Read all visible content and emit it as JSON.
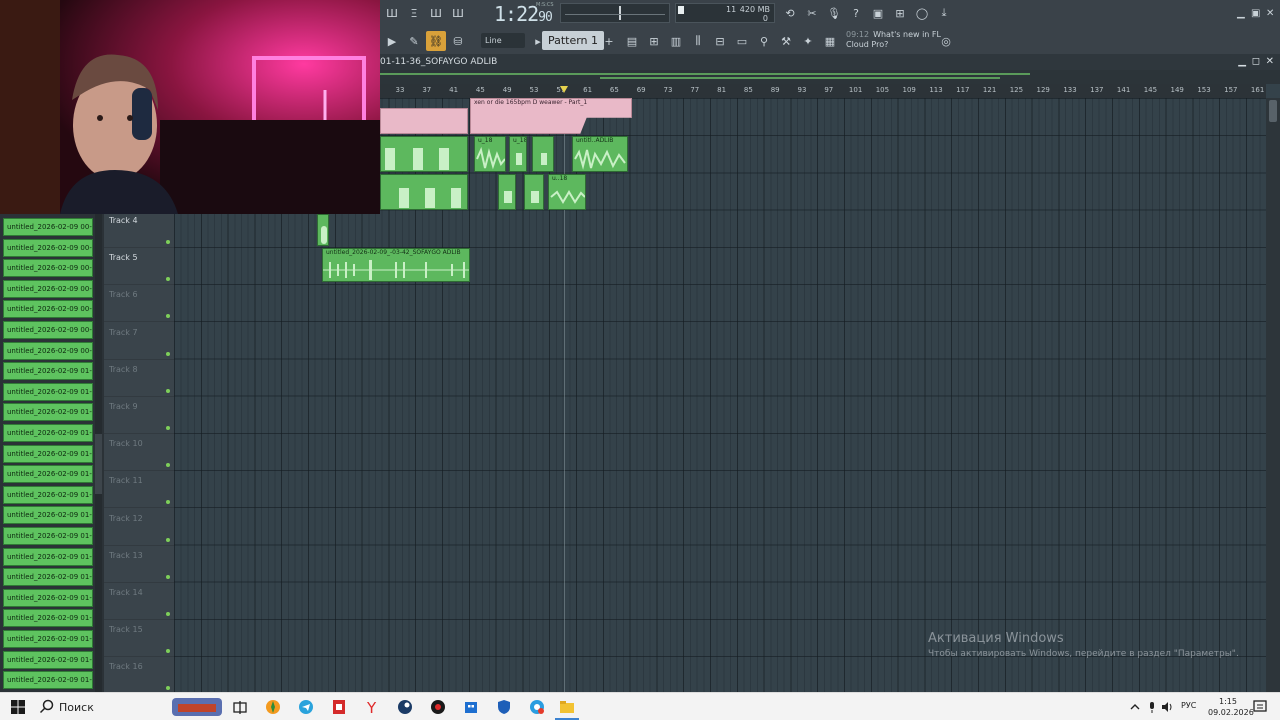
{
  "toolbar": {
    "time": "1:22",
    "time_ms": "90",
    "time_label": "M:S:CS",
    "memory": "420 MB",
    "cpu": "11",
    "voices": "0",
    "snap_mode": "Line",
    "pattern": "Pattern 1",
    "news_time": "09:12",
    "news_text_1": "What's new in FL",
    "news_text_2": "Cloud Pro?"
  },
  "playlist": {
    "title": "01-11-36_SOFAYGO ADLIB",
    "ruler_ticks": [
      "33",
      "37",
      "41",
      "45",
      "49",
      "53",
      "57",
      "61",
      "65",
      "69",
      "73",
      "77",
      "81",
      "85",
      "89",
      "93",
      "97",
      "101",
      "105",
      "109",
      "113",
      "117",
      "121",
      "125",
      "129",
      "133",
      "137",
      "141",
      "145",
      "149",
      "153",
      "157",
      "161"
    ],
    "tracks": [
      {
        "label": "Track 4",
        "dim": false
      },
      {
        "label": "Track 5",
        "dim": false
      },
      {
        "label": "Track 6",
        "dim": true
      },
      {
        "label": "Track 7",
        "dim": true
      },
      {
        "label": "Track 8",
        "dim": true
      },
      {
        "label": "Track 9",
        "dim": true
      },
      {
        "label": "Track 10",
        "dim": true
      },
      {
        "label": "Track 11",
        "dim": true
      },
      {
        "label": "Track 12",
        "dim": true
      },
      {
        "label": "Track 13",
        "dim": true
      },
      {
        "label": "Track 14",
        "dim": true
      },
      {
        "label": "Track 15",
        "dim": true
      },
      {
        "label": "Track 16",
        "dim": true
      }
    ],
    "clips": {
      "pattern_clip": "xen or die 165bpm D weawer - Part_1",
      "clip_a": "u_18",
      "clip_b": "u_18",
      "clip_c": "untitl..ADLIB",
      "clip_d": "u..18",
      "track5_clip": "untitled_2026-02-09_-03-42_SOFAYGO ADLIB"
    }
  },
  "browser": {
    "items": [
      "untitled_2026-02-09 00-",
      "untitled_2026-02-09 00-",
      "untitled_2026-02-09 00-",
      "untitled_2026-02-09 00-",
      "untitled_2026-02-09 00-",
      "untitled_2026-02-09 00-",
      "untitled_2026-02-09 00-",
      "untitled_2026-02-09 01-",
      "untitled_2026-02-09 01-",
      "untitled_2026-02-09 01-",
      "untitled_2026-02-09 01-",
      "untitled_2026-02-09 01-",
      "untitled_2026-02-09 01-",
      "untitled_2026-02-09 01-",
      "untitled_2026-02-09 01-",
      "untitled_2026-02-09 01-",
      "untitled_2026-02-09 01-",
      "untitled_2026-02-09 01-",
      "untitled_2026-02-09 01-",
      "untitled_2026-02-09 01-",
      "untitled_2026-02-09 01-",
      "untitled_2026-02-09 01-",
      "untitled_2026-02-09 01-"
    ]
  },
  "watermark": {
    "title": "Активация Windows",
    "subtitle": "Чтобы активировать Windows, перейдите в раздел \"Параметры\"."
  },
  "taskbar": {
    "search": "Поиск",
    "lang": "РУС",
    "time": "1:15",
    "date": "09.02.2026"
  },
  "colors": {
    "accent_green": "#5db85e",
    "pattern_pink": "#e9b9c8",
    "playhead_yellow": "#e6d24e"
  }
}
